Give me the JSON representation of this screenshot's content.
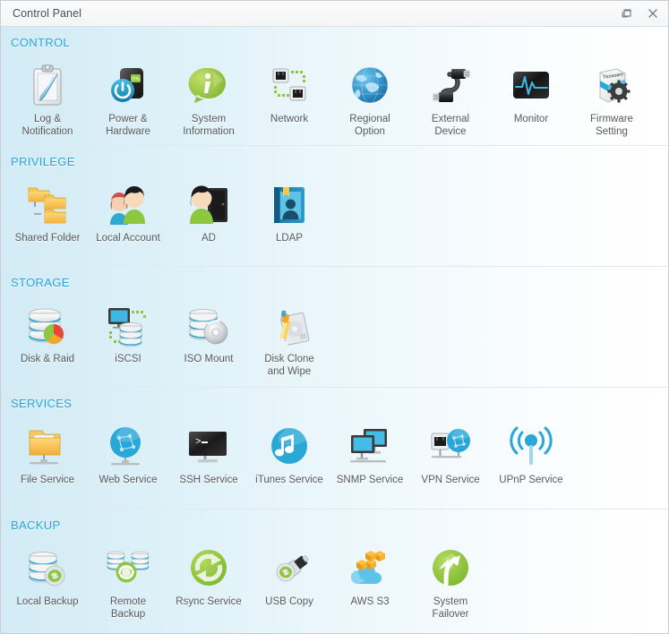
{
  "window": {
    "title": "Control Panel",
    "restore_label": "Restore",
    "close_label": "Close"
  },
  "sections": [
    {
      "id": "control",
      "title": "CONTROL",
      "items": [
        {
          "label": "Log &\nNotification",
          "icon": "clipboard-pen-icon",
          "name": "log-and-notification"
        },
        {
          "label": "Power &\nHardware",
          "icon": "power-hardware-icon",
          "name": "power-and-hardware"
        },
        {
          "label": "System\nInformation",
          "icon": "info-bubble-icon",
          "name": "system-information"
        },
        {
          "label": "Network",
          "icon": "network-ports-icon",
          "name": "network"
        },
        {
          "label": "Regional\nOption",
          "icon": "globe-icon",
          "name": "regional-option"
        },
        {
          "label": "External\nDevice",
          "icon": "usb-cable-icon",
          "name": "external-device"
        },
        {
          "label": "Monitor",
          "icon": "heartbeat-monitor-icon",
          "name": "monitor"
        },
        {
          "label": "Firmware\nSetting",
          "icon": "firmware-gear-icon",
          "name": "firmware-setting"
        }
      ]
    },
    {
      "id": "privilege",
      "title": "PRIVILEGE",
      "items": [
        {
          "label": "Shared Folder",
          "icon": "shared-folder-icon",
          "name": "shared-folder"
        },
        {
          "label": "Local Account",
          "icon": "two-users-icon",
          "name": "local-account"
        },
        {
          "label": "AD",
          "icon": "user-server-icon",
          "name": "ad"
        },
        {
          "label": "LDAP",
          "icon": "address-book-icon",
          "name": "ldap"
        }
      ]
    },
    {
      "id": "storage",
      "title": "STORAGE",
      "items": [
        {
          "label": "Disk & Raid",
          "icon": "disk-raid-icon",
          "name": "disk-and-raid"
        },
        {
          "label": "iSCSI",
          "icon": "iscsi-icon",
          "name": "iscsi"
        },
        {
          "label": "ISO Mount",
          "icon": "iso-mount-icon",
          "name": "iso-mount"
        },
        {
          "label": "Disk Clone\nand Wipe",
          "icon": "disk-clone-wipe-icon",
          "name": "disk-clone-and-wipe"
        }
      ]
    },
    {
      "id": "services",
      "title": "SERVICES",
      "items": [
        {
          "label": "File Service",
          "icon": "file-service-icon",
          "name": "file-service"
        },
        {
          "label": "Web Service",
          "icon": "web-service-icon",
          "name": "web-service"
        },
        {
          "label": "SSH Service",
          "icon": "ssh-terminal-icon",
          "name": "ssh-service"
        },
        {
          "label": "iTunes Service",
          "icon": "music-note-icon",
          "name": "itunes-service"
        },
        {
          "label": "SNMP Service",
          "icon": "two-monitors-icon",
          "name": "snmp-service"
        },
        {
          "label": "VPN Service",
          "icon": "vpn-icon",
          "name": "vpn-service"
        },
        {
          "label": "UPnP Service",
          "icon": "upnp-broadcast-icon",
          "name": "upnp-service"
        }
      ]
    },
    {
      "id": "backup",
      "title": "BACKUP",
      "items": [
        {
          "label": "Local Backup",
          "icon": "local-backup-icon",
          "name": "local-backup"
        },
        {
          "label": "Remote\nBackup",
          "icon": "remote-backup-icon",
          "name": "remote-backup"
        },
        {
          "label": "Rsync Service",
          "icon": "rsync-circle-icon",
          "name": "rsync-service"
        },
        {
          "label": "USB Copy",
          "icon": "usb-copy-icon",
          "name": "usb-copy"
        },
        {
          "label": "AWS S3",
          "icon": "aws-s3-icon",
          "name": "aws-s3"
        },
        {
          "label": "System\nFailover",
          "icon": "failover-arrow-icon",
          "name": "system-failover"
        }
      ]
    }
  ],
  "colors": {
    "section_title": "#29a3d8",
    "label": "#58595b",
    "titlebar_text": "#4a5059",
    "accent_blue": "#29a8d8",
    "accent_green": "#8dc63f"
  }
}
